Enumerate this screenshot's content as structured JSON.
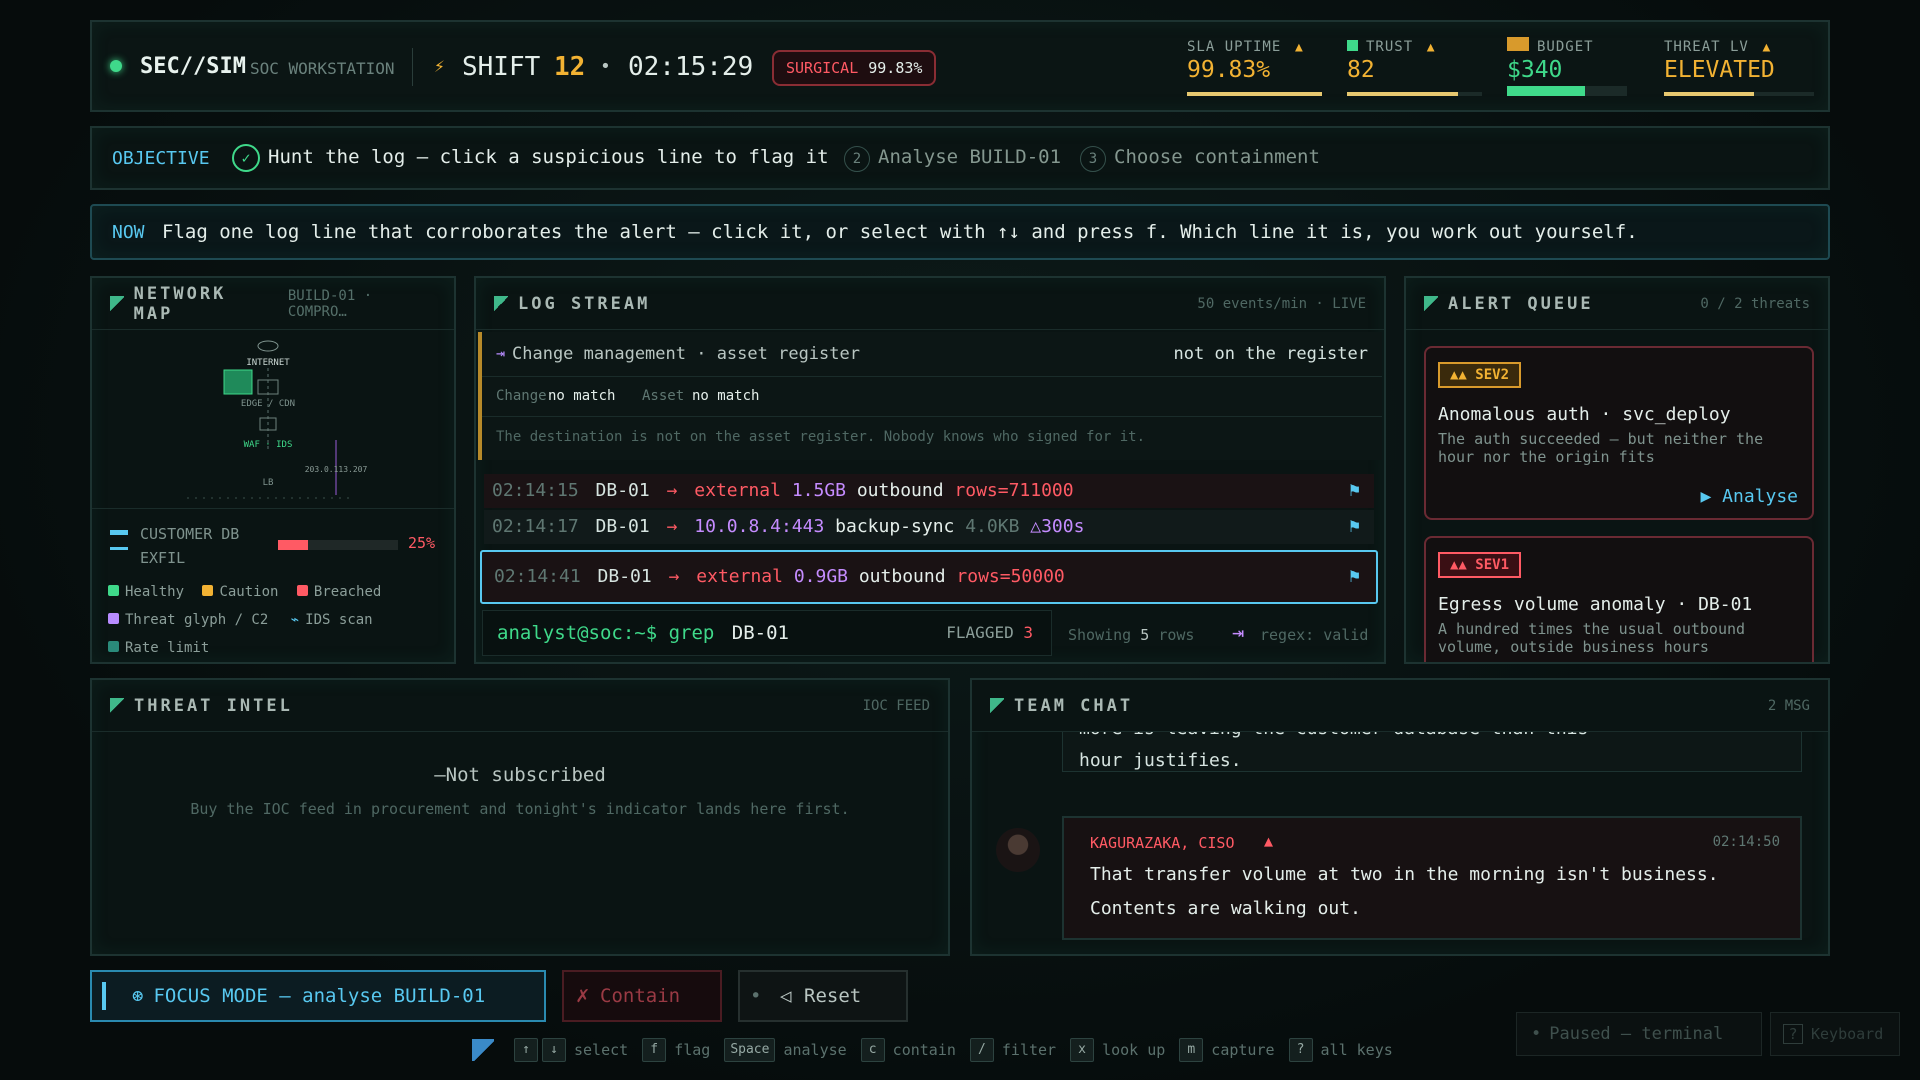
{
  "topbar": {
    "brand": "SEC//SIM",
    "brand_sub": "SOC WORKSTATION",
    "shift_label": "SHIFT",
    "shift_num": "12",
    "clock": "02:15:29",
    "mode_label": "SURGICAL",
    "mode_value": "99.83%",
    "stats": [
      {
        "label": "SLA UPTIME",
        "value": "99.83%",
        "level": 0.998
      },
      {
        "label": "TRUST",
        "value": "82",
        "level": 0.82
      },
      {
        "label": "BUDGET",
        "value": "$340",
        "level": 0.6
      },
      {
        "label": "THREAT LV",
        "value": "ELEVATED",
        "level": 0.6
      }
    ]
  },
  "objective": {
    "label": "OBJECTIVE",
    "steps": [
      {
        "num": "✓",
        "text": "Hunt the log — click a suspicious line to flag it"
      },
      {
        "num": "2",
        "text": "Analyse BUILD-01"
      },
      {
        "num": "3",
        "text": "Choose containment"
      }
    ]
  },
  "now": {
    "label": "NOW",
    "text": "Flag one log line that corroborates the alert — click it, or select with ↑↓ and press f. Which line it is, you work out yourself."
  },
  "network_map": {
    "title": "NETWORK MAP",
    "sub": "BUILD-01 · COMPRO…",
    "nodes": [
      "INTERNET",
      "EDGE / CDN",
      "WAF · IDS",
      "LB",
      "203.0.113.207"
    ],
    "exfil_label": "CUSTOMER DB EXFIL",
    "exfil_value": "25%",
    "exfil_level": 0.25,
    "legend": [
      "Healthy",
      "Caution",
      "Breached",
      "Threat glyph / C2",
      "IDS scan",
      "Rate limit"
    ]
  },
  "log_stream": {
    "title": "LOG STREAM",
    "rate": "50 events/min · LIVE",
    "context_title": "Change management · asset register",
    "context_status": "not on the register",
    "change_label": "Change",
    "change_value": "no match",
    "asset_label": "Asset",
    "asset_value": "no match",
    "context_note": "The destination is not on the asset register. Nobody knows who signed for it.",
    "lines": [
      {
        "time": "02:14:15",
        "host": "DB-01",
        "arrow": "→",
        "dest": "external",
        "size": "1.5GB",
        "dir": "outbound",
        "extra": "rows=711000"
      },
      {
        "time": "02:14:17",
        "host": "DB-01",
        "arrow": "→",
        "dest": "10.0.8.4:443",
        "size": "backup-sync",
        "dir": "4.0KB",
        "extra": "△300s"
      },
      {
        "time": "02:14:41",
        "host": "DB-01",
        "arrow": "→",
        "dest": "external",
        "size": "0.9GB",
        "dir": "outbound",
        "extra": "rows=50000"
      }
    ],
    "prompt": "analyst@soc:~$ grep",
    "query": "DB-01",
    "flagged_label": "FLAGGED",
    "flagged_count": "3",
    "showing_label": "Showing",
    "showing_count": "5",
    "showing_unit": "rows",
    "regex_status": "regex: valid"
  },
  "alert_queue": {
    "title": "ALERT QUEUE",
    "count": "0 / 2 threats",
    "alerts": [
      {
        "sev": "SEV2",
        "title": "Anomalous auth · svc_deploy",
        "desc": "The auth succeeded — but neither the hour nor the origin fits",
        "action": "Analyse"
      },
      {
        "sev": "SEV1",
        "title": "Egress volume anomaly · DB-01",
        "desc": "A hundred times the usual outbound volume, outside business hours"
      }
    ]
  },
  "threat_intel": {
    "title": "THREAT INTEL",
    "sub": "IOC FEED",
    "status": "—Not subscribed",
    "note": "Buy the IOC feed in procurement and tonight's indicator lands here first."
  },
  "team_chat": {
    "title": "TEAM CHAT",
    "count": "2 MSG",
    "partial_line1": "more is leaving the customer database than this",
    "partial_line2": "hour justifies.",
    "message": {
      "author": "KAGURAZAKA, CISO",
      "time": "02:14:50",
      "line1": "That transfer volume at two in the morning isn't business.",
      "line2": "Contents are walking out."
    }
  },
  "actions": {
    "focus": "FOCUS MODE — analyse BUILD-01",
    "contain": "Contain",
    "reset": "Reset"
  },
  "hotkeys": [
    {
      "keys": [
        "↑",
        "↓"
      ],
      "label": "select"
    },
    {
      "keys": [
        "f"
      ],
      "label": "flag"
    },
    {
      "keys": [
        "Space"
      ],
      "label": "analyse"
    },
    {
      "keys": [
        "c"
      ],
      "label": "contain"
    },
    {
      "keys": [
        "/"
      ],
      "label": "filter"
    },
    {
      "keys": [
        "x"
      ],
      "label": "look up"
    },
    {
      "keys": [
        "m"
      ],
      "label": "capture"
    },
    {
      "keys": [
        "?"
      ],
      "label": "all keys"
    }
  ],
  "status": {
    "paused": "Paused — terminal",
    "keyboard": "Keyboard"
  },
  "colors": {
    "accent": "#3fd98a",
    "danger": "#ff5a64",
    "warning": "#f2b233",
    "info": "#58c8f0"
  }
}
